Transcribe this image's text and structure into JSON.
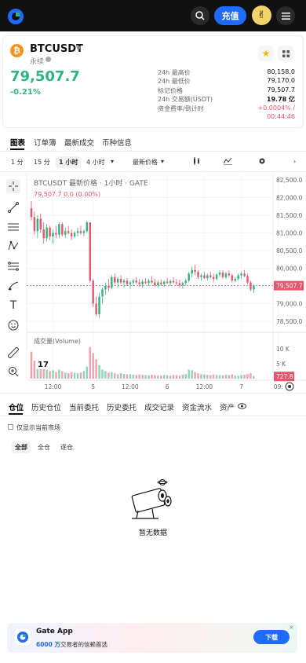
{
  "topbar": {
    "deposit_label": "充值",
    "avatar_emoji": "✌"
  },
  "ticker": {
    "coin_symbol": "₿",
    "pair": "BTCUSDT",
    "perp_label": "永续",
    "last_price": "79,507.7",
    "change_pct": "-0.21%",
    "stats": [
      {
        "label": "24h 最高价",
        "value": "80,158.0"
      },
      {
        "label": "24h 最低价",
        "value": "79,170.0"
      },
      {
        "label": "标记价格",
        "value": "79,507.7"
      },
      {
        "label": "24h 交易额(USDT)",
        "value": "19.78 亿"
      },
      {
        "label": "资金费率/倒计时",
        "value": "+0.0004% /"
      },
      {
        "label": "",
        "value": "00:44:46"
      }
    ]
  },
  "tabs": [
    "图表",
    "订单簿",
    "最新成交",
    "币种信息"
  ],
  "timeframes": [
    "1 分",
    "15 分",
    "1 小时",
    "4 小时",
    "最新价格"
  ],
  "chart_data": {
    "type": "candlestick",
    "title": "BTCUSDT 最新价格 · 1小时 · GATE",
    "ohlc_label": "79,507.7  0.0  (0.00%)",
    "y_ticks": [
      "82,500.0",
      "82,000.0",
      "81,500.0",
      "81,000.0",
      "80,500.0",
      "80,000.0",
      "79,507.7",
      "79,000.0",
      "78,500.0"
    ],
    "ylim": [
      78300,
      82600
    ],
    "x_ticks": [
      "12:00",
      "5",
      "12:00",
      "6",
      "12:00",
      "7",
      "09:"
    ],
    "price_line": 79507.7,
    "volume_label": "成交量(Volume)",
    "volume_ticks": [
      "10 K",
      "5 K",
      "727.8"
    ],
    "volume_ylim": [
      0,
      11000
    ],
    "candles": [
      [
        81700,
        81900,
        81350,
        81450
      ],
      [
        81450,
        81600,
        80950,
        81050
      ],
      [
        81050,
        81500,
        80850,
        81400
      ],
      [
        81400,
        81550,
        81000,
        81100
      ],
      [
        81100,
        81300,
        80700,
        80850
      ],
      [
        80850,
        81250,
        80750,
        81150
      ],
      [
        81150,
        81200,
        80800,
        80900
      ],
      [
        80900,
        81100,
        80700,
        81000
      ],
      [
        81000,
        81200,
        80850,
        80950
      ],
      [
        80950,
        81300,
        80850,
        81250
      ],
      [
        81250,
        81300,
        80900,
        80950
      ],
      [
        80950,
        81150,
        80850,
        81050
      ],
      [
        81050,
        81200,
        80950,
        81000
      ],
      [
        81000,
        81100,
        80800,
        80900
      ],
      [
        80900,
        81050,
        80850,
        81000
      ],
      [
        81000,
        81150,
        80900,
        81050
      ],
      [
        81050,
        81200,
        80950,
        81000
      ],
      [
        81000,
        81100,
        80900,
        81050
      ],
      [
        81050,
        81350,
        81000,
        81300
      ],
      [
        81300,
        81250,
        79600,
        79650
      ],
      [
        79650,
        79700,
        78900,
        79000
      ],
      [
        79000,
        79200,
        78650,
        78700
      ],
      [
        78700,
        79300,
        78600,
        79200
      ],
      [
        79200,
        79450,
        79000,
        79400
      ],
      [
        79400,
        79600,
        79250,
        79500
      ],
      [
        79500,
        79700,
        79350,
        79450
      ],
      [
        79450,
        79800,
        79400,
        79750
      ],
      [
        79750,
        79850,
        79550,
        79600
      ],
      [
        79600,
        79750,
        79450,
        79700
      ],
      [
        79700,
        79800,
        79550,
        79600
      ],
      [
        79600,
        79700,
        79450,
        79650
      ],
      [
        79650,
        79720,
        79500,
        79550
      ],
      [
        79550,
        79650,
        79420,
        79600
      ],
      [
        79600,
        79700,
        79500,
        79650
      ],
      [
        79650,
        79750,
        79550,
        79600
      ],
      [
        79600,
        79700,
        79480,
        79550
      ],
      [
        79550,
        79680,
        79450,
        79620
      ],
      [
        79620,
        79720,
        79550,
        79580
      ],
      [
        79580,
        79700,
        79500,
        79650
      ],
      [
        79650,
        79780,
        79560,
        79600
      ],
      [
        79600,
        79700,
        79480,
        79520
      ],
      [
        79520,
        79650,
        79450,
        79600
      ],
      [
        79600,
        79680,
        79500,
        79550
      ],
      [
        79550,
        79660,
        79470,
        79620
      ],
      [
        79620,
        79720,
        79550,
        79580
      ],
      [
        79580,
        79680,
        79500,
        79640
      ],
      [
        79640,
        79750,
        79560,
        79600
      ],
      [
        79600,
        79700,
        79520,
        79580
      ],
      [
        79580,
        79680,
        79450,
        79520
      ],
      [
        79520,
        79620,
        79420,
        79580
      ],
      [
        79580,
        79700,
        79500,
        79650
      ],
      [
        79650,
        79900,
        79600,
        79850
      ],
      [
        79850,
        80050,
        79750,
        79950
      ],
      [
        79950,
        80100,
        79800,
        79900
      ],
      [
        79900,
        79950,
        79700,
        79750
      ],
      [
        79750,
        79850,
        79650,
        79800
      ],
      [
        79800,
        79900,
        79700,
        79720
      ],
      [
        79720,
        79850,
        79650,
        79800
      ],
      [
        79800,
        79900,
        79700,
        79750
      ],
      [
        79750,
        79850,
        79600,
        79700
      ],
      [
        79700,
        79850,
        79650,
        79820
      ],
      [
        79820,
        79950,
        79750,
        79880
      ],
      [
        79880,
        79950,
        79700,
        79750
      ],
      [
        79750,
        79900,
        79700,
        79850
      ],
      [
        79850,
        79950,
        79750,
        79800
      ],
      [
        79800,
        79850,
        79600,
        79650
      ],
      [
        79650,
        79750,
        79600,
        79700
      ],
      [
        79700,
        79850,
        79650,
        79800
      ],
      [
        79800,
        79900,
        79700,
        79850
      ],
      [
        79850,
        79950,
        79750,
        79780
      ],
      [
        79780,
        79850,
        79550,
        79600
      ],
      [
        79600,
        79650,
        79350,
        79400
      ],
      [
        79400,
        79550,
        79300,
        79507.7
      ]
    ],
    "volumes": [
      9000,
      6000,
      5000,
      4000,
      3500,
      3000,
      2500,
      2800,
      2200,
      3000,
      2500,
      2000,
      1800,
      2200,
      2000,
      1800,
      2000,
      2500,
      4000,
      10500,
      8500,
      6500,
      4500,
      3000,
      2500,
      2000,
      2200,
      1800,
      1500,
      1800,
      1600,
      1400,
      1500,
      1300,
      1200,
      1400,
      1300,
      1200,
      1100,
      1300,
      1200,
      1100,
      1000,
      1200,
      1100,
      1000,
      1200,
      1100,
      1000,
      1300,
      1500,
      3000,
      2800,
      2200,
      1800,
      1500,
      1400,
      1300,
      1200,
      1400,
      1300,
      1200,
      1100,
      1300,
      1200,
      1400,
      1100,
      1000,
      1200,
      1300,
      1500,
      1800,
      900
    ]
  },
  "positions": {
    "tabs": [
      "仓位",
      "历史仓位",
      "当前委托",
      "历史委托",
      "成交记录",
      "资金流水",
      "资产"
    ],
    "only_current_label": "仅显示当前市场",
    "filters": [
      "全部",
      "全仓",
      "逐仓"
    ],
    "empty_text": "暂无数据"
  },
  "banner": {
    "title": "Gate App",
    "sub_highlight": "6000 万",
    "sub_rest": "交易者的信赖首选",
    "button_label": "下载",
    "close": "×"
  },
  "colors": {
    "up": "#2fb47c",
    "down": "#e8566b",
    "accent": "#1f6bff"
  }
}
